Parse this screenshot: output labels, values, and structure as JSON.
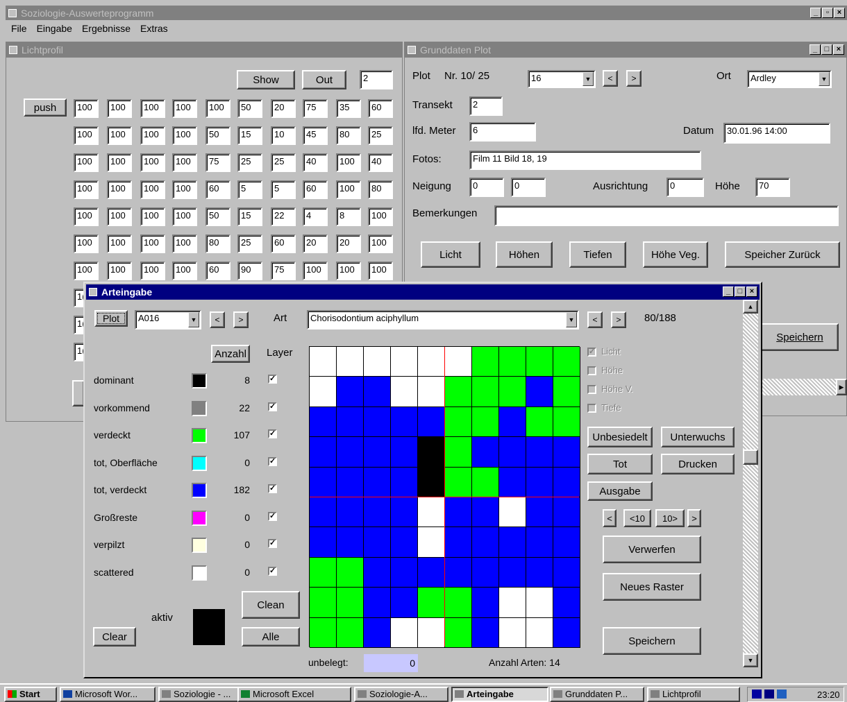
{
  "app": {
    "title": "Soziologie-Auswerteprogramm"
  },
  "menu": [
    "File",
    "Eingabe",
    "Ergebnisse",
    "Extras"
  ],
  "licht": {
    "title": "Lichtprofil",
    "show": "Show",
    "out": "Out",
    "value": "2",
    "push": "push",
    "rows": [
      [
        "100",
        "100",
        "100",
        "100",
        "100",
        "50",
        "20",
        "75",
        "35",
        "60"
      ],
      [
        "100",
        "100",
        "100",
        "100",
        "50",
        "15",
        "10",
        "45",
        "80",
        "25"
      ],
      [
        "100",
        "100",
        "100",
        "100",
        "75",
        "25",
        "25",
        "40",
        "100",
        "40"
      ],
      [
        "100",
        "100",
        "100",
        "100",
        "60",
        "5",
        "5",
        "60",
        "100",
        "80"
      ],
      [
        "100",
        "100",
        "100",
        "100",
        "50",
        "15",
        "22",
        "4",
        "8",
        "100"
      ],
      [
        "100",
        "100",
        "100",
        "100",
        "80",
        "25",
        "60",
        "20",
        "20",
        "100"
      ],
      [
        "100",
        "100",
        "100",
        "100",
        "60",
        "90",
        "75",
        "100",
        "100",
        "100"
      ],
      [
        "1(",
        "",
        "",
        "",
        "",
        "",
        "",
        "",
        "",
        ""
      ],
      [
        "1(",
        "",
        "",
        "",
        "",
        "",
        "",
        "",
        "",
        ""
      ],
      [
        "1(",
        "",
        "",
        "",
        "",
        "",
        "",
        "",
        "",
        ""
      ]
    ]
  },
  "grund": {
    "title": "Grunddaten Plot",
    "plot_label": "Plot",
    "plot_nr": "Nr. 10/ 25",
    "plot_value": "16",
    "ort_label": "Ort",
    "ort_value": "Ardley",
    "transekt_label": "Transekt",
    "transekt_value": "2",
    "meter_label": "lfd. Meter",
    "meter_value": "6",
    "datum_label": "Datum",
    "datum_value": "30.01.96 14:00",
    "fotos_label": "Fotos:",
    "fotos_value": "Film 11 Bild 18, 19",
    "neigung_label": "Neigung",
    "neigung_1": "0",
    "neigung_2": "0",
    "ausrichtung_label": "Ausrichtung",
    "ausrichtung_value": "0",
    "hoehe_label": "Höhe",
    "hoehe_value": "70",
    "bemerkungen_label": "Bemerkungen",
    "bemerkungen_value": "",
    "buttons": [
      "Licht",
      "Höhen",
      "Tiefen",
      "Höhe Veg.",
      "Speicher Zurück"
    ],
    "speichern": "Speichern"
  },
  "arten": {
    "title": "Arteingabe",
    "plot_btn": "Plot",
    "plot_value": "A016",
    "art_label": "Art",
    "art_value": "Chorisodontium aciphyllum",
    "art_count": "80/188",
    "anzahl_btn": "Anzahl",
    "layer_label": "Layer",
    "categories": [
      {
        "name": "dominant",
        "color": "#000000",
        "count": "8"
      },
      {
        "name": "vorkommend",
        "color": "#808080",
        "count": "22"
      },
      {
        "name": "verdeckt",
        "color": "#00ff00",
        "count": "107"
      },
      {
        "name": "tot, Oberfläche",
        "color": "#00ffff",
        "count": "0"
      },
      {
        "name": "tot, verdeckt",
        "color": "#0000ff",
        "count": "182"
      },
      {
        "name": "Großreste",
        "color": "#ff00ff",
        "count": "0"
      },
      {
        "name": "verpilzt",
        "color": "#ffffe0",
        "count": "0"
      },
      {
        "name": "scattered",
        "color": "#ffffff",
        "count": "0"
      }
    ],
    "aktiv_label": "aktiv",
    "clean_btn": "Clean",
    "alle_btn": "Alle",
    "clear_btn": "Clear",
    "unbelegt_label": "unbelegt:",
    "unbelegt_value": "0",
    "anzahl_arten": "Anzahl Arten: 14",
    "checks": [
      "Licht",
      "Höhe",
      "Höhe V.",
      "Tiefe"
    ],
    "unbesiedelt": "Unbesiedelt",
    "unterwuchs": "Unterwuchs",
    "tot": "Tot",
    "drucken": "Drucken",
    "ausgabe": "Ausgabe",
    "nav": [
      "<",
      "<10",
      "10>",
      ">"
    ],
    "verwerfen": "Verwerfen",
    "neues_raster": "Neues Raster",
    "speichern": "Speichern",
    "grid": [
      "WWWWWWGGGG",
      "WBBWWGGGBG",
      "BBBBBGGBGG",
      "BBBBKGBBBB",
      "BBBBKGGBBB",
      "BBBBWBBWBB",
      "BBBBWBBBBB",
      "GGBBBBBBBB",
      "GGBBGGBWWB",
      "GGBWWGBWWB"
    ]
  },
  "taskbar": {
    "start": "Start",
    "items": [
      "Microsoft Wor...",
      "Soziologie - ...",
      "Microsoft Excel",
      "Soziologie-A...",
      "Arteingabe",
      "Grunddaten P...",
      "Lichtprofil"
    ],
    "time": "23:20"
  }
}
